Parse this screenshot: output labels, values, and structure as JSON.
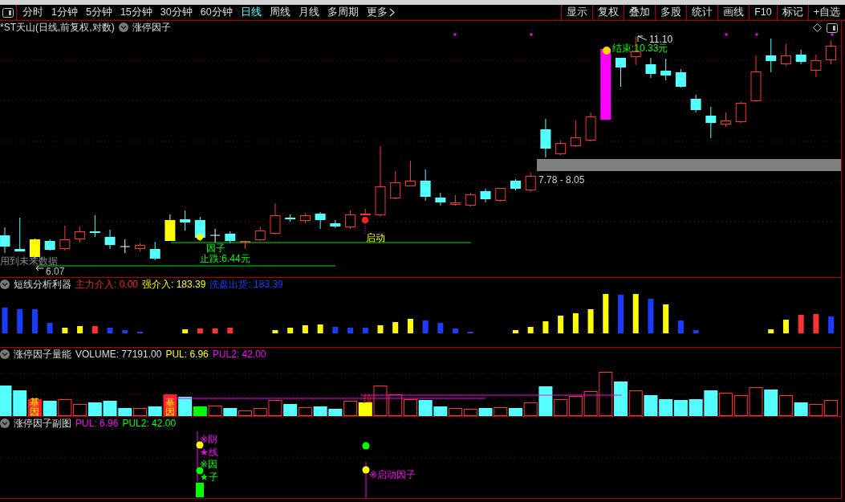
{
  "toolbar": {
    "periods": [
      {
        "label": "分时",
        "selected": false
      },
      {
        "label": "1分钟",
        "selected": false
      },
      {
        "label": "5分钟",
        "selected": false
      },
      {
        "label": "15分钟",
        "selected": false
      },
      {
        "label": "30分钟",
        "selected": false
      },
      {
        "label": "60分钟",
        "selected": false
      },
      {
        "label": "日线",
        "selected": true
      },
      {
        "label": "周线",
        "selected": false
      },
      {
        "label": "月线",
        "selected": false
      },
      {
        "label": "多周期",
        "selected": false
      }
    ],
    "more": {
      "label": "更多"
    },
    "actions": [
      "显示",
      "复权",
      "叠加",
      "多股",
      "统计",
      "画线",
      "F10",
      "标记",
      "+自选"
    ]
  },
  "main_chart": {
    "title": "*ST天山(日线,前复权,对数)",
    "indicator": "涨停因子",
    "annotations": [
      {
        "kind": "high_mark",
        "text": "11.10"
      },
      {
        "kind": "end_price",
        "text": "结束:10.33元"
      },
      {
        "kind": "zone",
        "text": "7.78 - 8.05"
      },
      {
        "kind": "factor",
        "text": "因子"
      },
      {
        "kind": "stop",
        "text": "止跌:6.44元"
      },
      {
        "kind": "start",
        "text": "启动"
      },
      {
        "kind": "warning",
        "text": "用到未来数据"
      },
      {
        "kind": "low_mark",
        "text": "6.07"
      }
    ]
  },
  "panels": [
    {
      "title": "短线分析利器",
      "values": [
        {
          "kind": "red",
          "text": "主力介入: 0.00"
        },
        {
          "kind": "yellow",
          "text": "强介入: 183.39"
        },
        {
          "kind": "blue",
          "text": "洗盘出货: 183.39"
        }
      ]
    },
    {
      "title": "涨停因子量能",
      "values": [
        {
          "kind": "white",
          "text": "VOLUME: 77191.00"
        },
        {
          "kind": "yellow",
          "text": "PUL: 6.96"
        },
        {
          "kind": "magenta",
          "text": "PUL2: 42.00"
        }
      ],
      "bar_labels": [
        {
          "kind": "gene",
          "text": "基因"
        },
        {
          "kind": "gene",
          "text": "基因"
        },
        {
          "kind": "pull",
          "text": "拉"
        }
      ]
    },
    {
      "title": "涨停因子副图",
      "values": [
        {
          "kind": "magenta",
          "text": "PUL: 6.96"
        },
        {
          "kind": "green",
          "text": "PUL2: 42.00"
        }
      ],
      "signals": [
        {
          "kind": "yin",
          "text": "※阴"
        },
        {
          "kind": "line",
          "text": "★线"
        },
        {
          "kind": "cause",
          "text": "※因"
        },
        {
          "kind": "child",
          "text": "★子"
        },
        {
          "kind": "start",
          "text": "※启动因子"
        }
      ]
    }
  ]
}
